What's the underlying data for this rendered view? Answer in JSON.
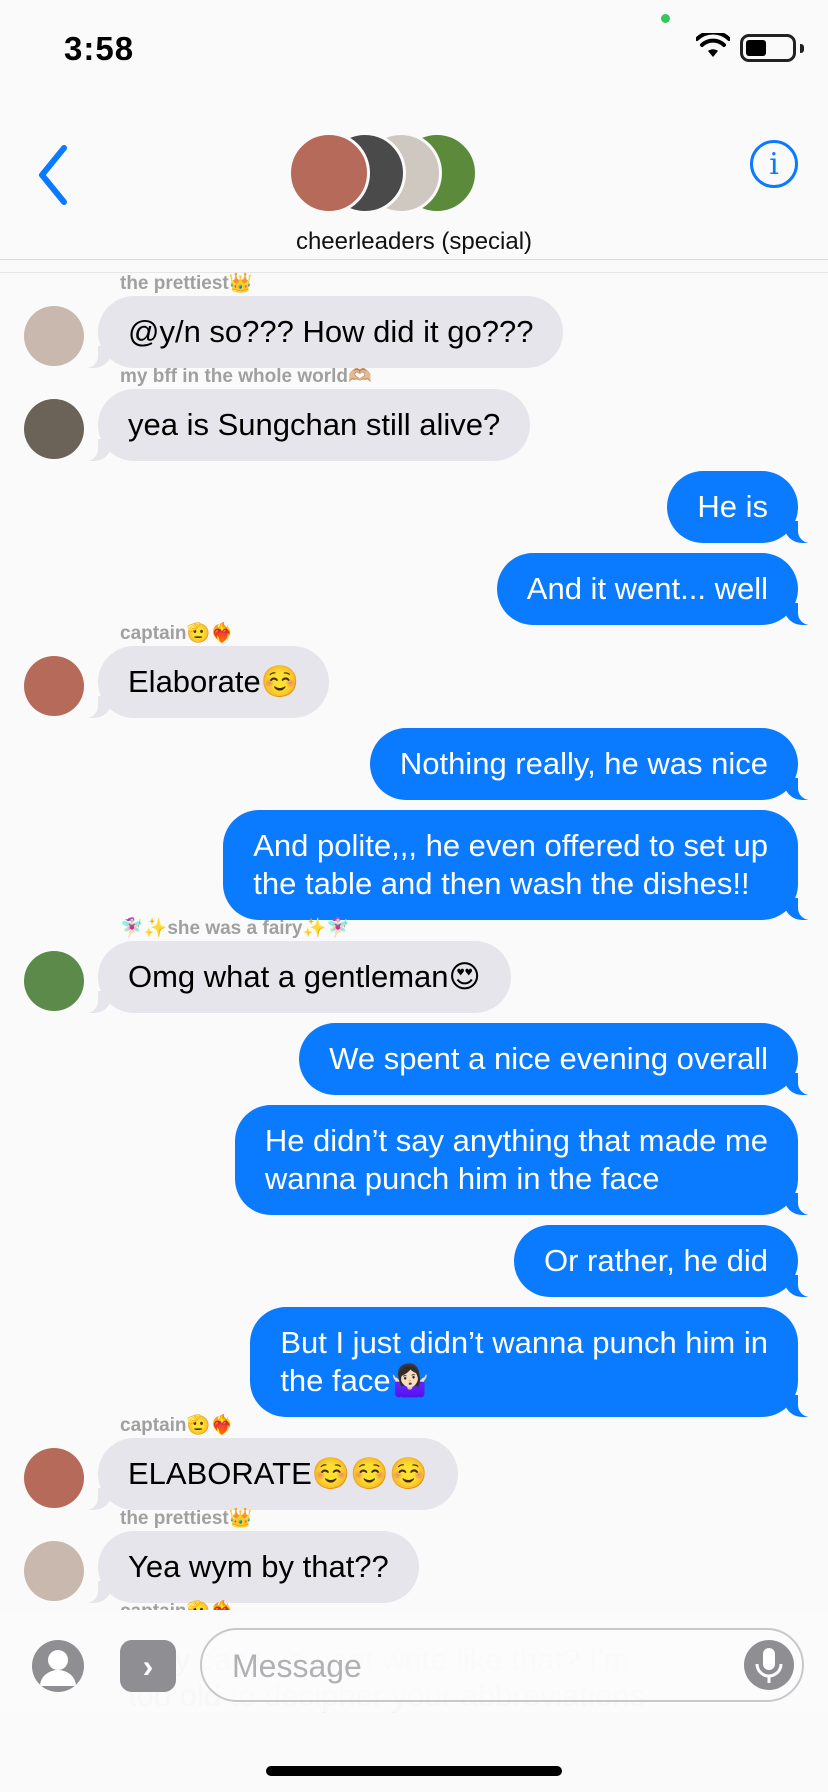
{
  "status_bar": {
    "time": "3:58"
  },
  "header": {
    "group_name": "cheerleaders (special)",
    "back_icon": "chevron-left-icon",
    "info_icon": "info-circle-icon",
    "info_glyph": "i",
    "avatar_colors": [
      "#b56a5a",
      "#4a4a4a",
      "#cfc8c0",
      "#5a8a3a"
    ]
  },
  "messages": [
    {
      "type": "sender",
      "text": "the prettiest👑"
    },
    {
      "type": "in",
      "avatar": "#c9b8ad",
      "lines": [
        "@y/n so??? How did it go???"
      ]
    },
    {
      "type": "sender",
      "text": "my bff in the whole world🫶🏼"
    },
    {
      "type": "in",
      "avatar": "#6b6258",
      "lines": [
        "yea is Sungchan still alive?"
      ]
    },
    {
      "type": "out",
      "lines": [
        "He is"
      ]
    },
    {
      "type": "out",
      "lines": [
        "And it went... well"
      ]
    },
    {
      "type": "sender",
      "text": "captain🫡❤️‍🔥"
    },
    {
      "type": "in",
      "avatar": "#b56a5a",
      "lines": [
        "Elaborate☺️"
      ]
    },
    {
      "type": "out",
      "lines": [
        "Nothing really, he was nice"
      ]
    },
    {
      "type": "out",
      "lines": [
        "And polite,,, he even offered to set up",
        "the table and then wash the dishes!!"
      ]
    },
    {
      "type": "sender",
      "text": "🧚🏻‍♀️✨she was a fairy✨🧚🏻‍♀️"
    },
    {
      "type": "in",
      "avatar": "#5c8a4a",
      "lines": [
        "Omg what a gentleman😍"
      ]
    },
    {
      "type": "out",
      "lines": [
        "We spent a nice evening overall"
      ]
    },
    {
      "type": "out",
      "lines": [
        "He didn’t say anything that made me",
        "wanna punch him in the face"
      ]
    },
    {
      "type": "out",
      "lines": [
        "Or rather, he did"
      ]
    },
    {
      "type": "out",
      "lines": [
        "But I just didn’t wanna punch him in",
        "the face🤷🏻‍♀️"
      ]
    },
    {
      "type": "sender",
      "text": "captain🫡❤️‍🔥"
    },
    {
      "type": "in",
      "avatar": "#b56a5a",
      "lines": [
        "ELABORATE☺️☺️☺️"
      ]
    },
    {
      "type": "sender",
      "text": "the prettiest👑"
    },
    {
      "type": "in",
      "avatar": "#c9b8ad",
      "lines": [
        "Yea wym by that??"
      ]
    },
    {
      "type": "sender",
      "text": "captain🫡❤️‍🔥"
    }
  ],
  "obscured_message": "Why can't you not write like that? I'm too old to decipher your abbreviations",
  "input_bar": {
    "placeholder": "Message",
    "contact_icon": "person-circle-icon",
    "apps_icon": "chevron-right-icon",
    "apps_glyph": "›",
    "mic_icon": "microphone-icon"
  },
  "colors": {
    "outgoing_bubble": "#0a7aff",
    "incoming_bubble": "#e6e5eb",
    "accent": "#0a7aff"
  }
}
